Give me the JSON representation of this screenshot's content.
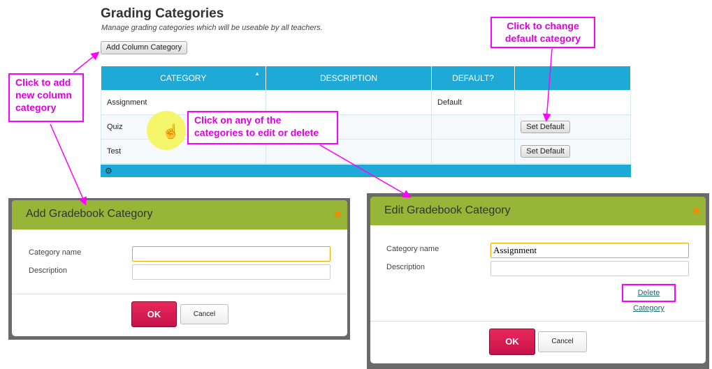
{
  "page": {
    "title": "Grading Categories",
    "subtitle": "Manage grading categories which will be useable by all teachers.",
    "add_button": "Add Column Category"
  },
  "table": {
    "headers": [
      "CATEGORY",
      "DESCRIPTION",
      "DEFAULT?",
      ""
    ],
    "rows": [
      {
        "category": "Assignment",
        "description": "",
        "default": "Default",
        "action": ""
      },
      {
        "category": "Quiz",
        "description": "",
        "default": "",
        "action": "Set Default"
      },
      {
        "category": "Test",
        "description": "",
        "default": "",
        "action": "Set Default"
      }
    ],
    "footer_icon": "gear-icon"
  },
  "callouts": {
    "add": "Click to add new column category",
    "default": "Click to change default category",
    "edit": "Click on any of the categories to edit or delete"
  },
  "add_dialog": {
    "title": "Add Gradebook Category",
    "name_label": "Category name",
    "name_value": "",
    "desc_label": "Description",
    "desc_value": "",
    "ok": "OK",
    "cancel": "Cancel"
  },
  "edit_dialog": {
    "title": "Edit Gradebook Category",
    "name_label": "Category name",
    "name_value": "Assignment",
    "desc_label": "Description",
    "desc_value": "",
    "delete": "Delete Category",
    "ok": "OK",
    "cancel": "Cancel"
  },
  "colors": {
    "header": "#1fa9d6",
    "dialog_header": "#97b637",
    "ok": "#e0225a",
    "callout": "#ff00ff"
  }
}
